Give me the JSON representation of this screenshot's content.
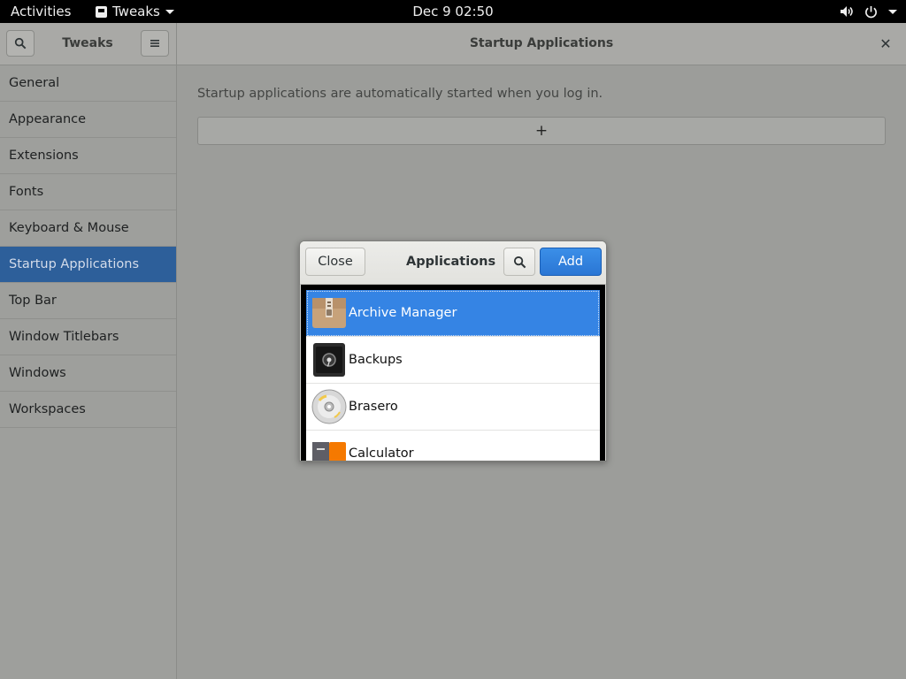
{
  "topbar": {
    "activities": "Activities",
    "app_name": "Tweaks",
    "clock": "Dec 9  02:50"
  },
  "headerbar": {
    "title": "Tweaks",
    "page_title": "Startup Applications",
    "close_glyph": "✕"
  },
  "sidebar": {
    "items": [
      {
        "label": "General"
      },
      {
        "label": "Appearance"
      },
      {
        "label": "Extensions"
      },
      {
        "label": "Fonts"
      },
      {
        "label": "Keyboard & Mouse"
      },
      {
        "label": "Startup Applications",
        "selected": true
      },
      {
        "label": "Top Bar"
      },
      {
        "label": "Window Titlebars"
      },
      {
        "label": "Windows"
      },
      {
        "label": "Workspaces"
      }
    ]
  },
  "main": {
    "description": "Startup applications are automatically started when you log in.",
    "add_glyph": "+"
  },
  "dialog": {
    "close_label": "Close",
    "title": "Applications",
    "add_label": "Add",
    "apps": [
      {
        "name": "Archive Manager",
        "icon": "archive-manager-icon",
        "selected": true
      },
      {
        "name": "Backups",
        "icon": "backups-icon"
      },
      {
        "name": "Brasero",
        "icon": "brasero-icon"
      },
      {
        "name": "Calculator",
        "icon": "calculator-icon"
      }
    ]
  },
  "colors": {
    "selection_blue": "#3584e4",
    "sidebar_selected": "#2d5f9a"
  }
}
